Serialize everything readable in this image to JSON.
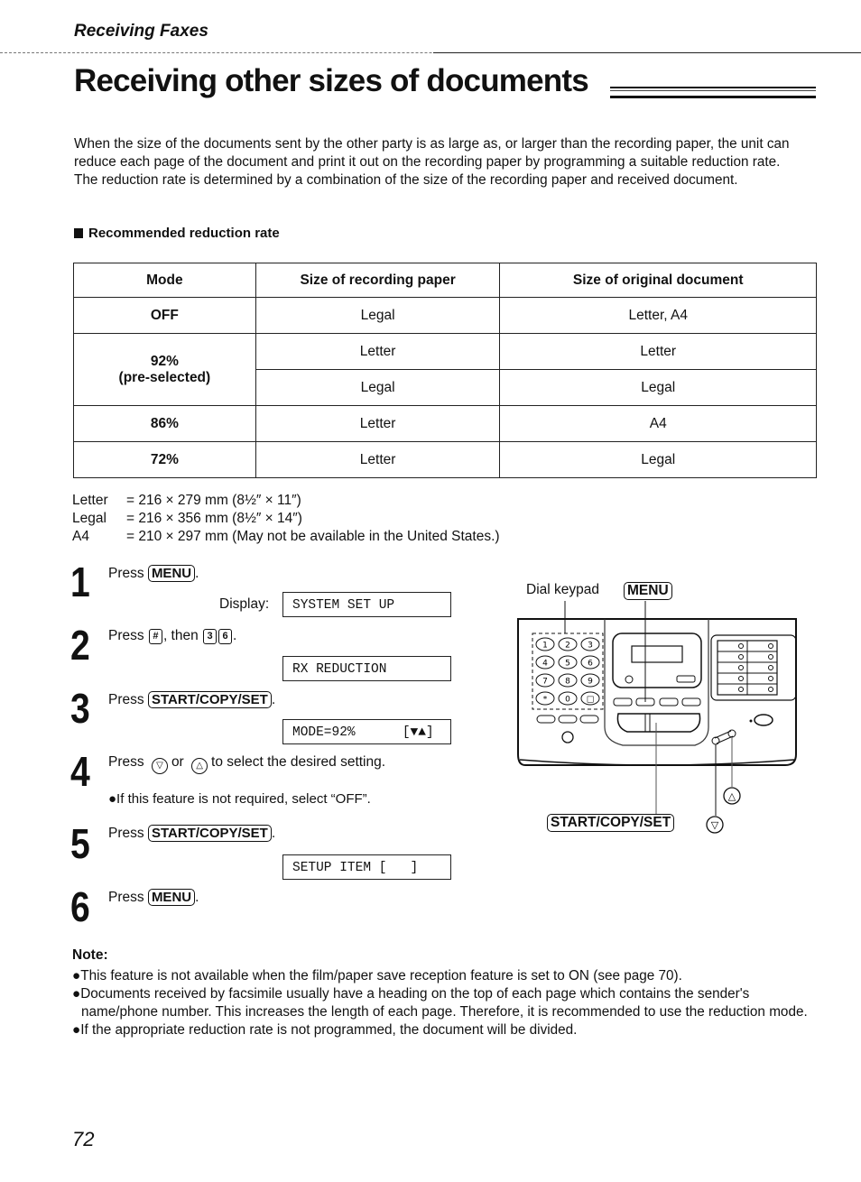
{
  "header": {
    "section": "Receiving Faxes",
    "title": "Receiving other sizes of documents"
  },
  "intro": {
    "paragraph1": "When the size of the documents sent by the other party is as large as, or larger than the recording paper, the unit can reduce each page of the document and print it out on the recording paper by programming a suitable reduction rate.",
    "paragraph2": "The reduction rate is determined by a combination of the size of the recording paper and received document."
  },
  "reduction_table": {
    "heading": "Recommended reduction rate",
    "columns": [
      "Mode",
      "Size of recording paper",
      "Size of original document"
    ],
    "rows": [
      {
        "mode": "OFF",
        "recording_paper": "Legal",
        "original_document": "Letter, A4"
      },
      {
        "mode": "92%",
        "mode_note": "(pre-selected)",
        "recording_paper": "Letter",
        "original_document": "Letter"
      },
      {
        "mode": "92%",
        "recording_paper": "Legal",
        "original_document": "Legal"
      },
      {
        "mode": "86%",
        "recording_paper": "Letter",
        "original_document": "A4"
      },
      {
        "mode": "72%",
        "recording_paper": "Letter",
        "original_document": "Legal"
      }
    ]
  },
  "paper_sizes": [
    {
      "name": "Letter",
      "value": "= 216 × 279 mm (8½″ × 11″)"
    },
    {
      "name": "Legal",
      "value": "= 216 × 356 mm (8½″ × 14″)"
    },
    {
      "name": "A4",
      "value": "= 210 × 297 mm (May not be available in the United States.)"
    }
  ],
  "steps": [
    {
      "number": "1",
      "prefix": "Press",
      "key": "MENU",
      "suffix": ".",
      "display_label": "Display:",
      "display": "SYSTEM SET UP"
    },
    {
      "number": "2",
      "prefix": "Press",
      "key": "#",
      "middle": ", then",
      "keys": [
        "3",
        "6"
      ],
      "suffix": ".",
      "display": "RX REDUCTION"
    },
    {
      "number": "3",
      "prefix": "Press",
      "key": "START/COPY/SET",
      "suffix": ".",
      "display": "MODE=92%      [▼▲]"
    },
    {
      "number": "4",
      "prefix": "Press",
      "key_down": "▽",
      "or": "or",
      "key_up": "△",
      "suffix": "to select the desired setting.",
      "bullet": "●If this feature is not required, select “OFF”."
    },
    {
      "number": "5",
      "prefix": "Press",
      "key": "START/COPY/SET",
      "suffix": ".",
      "display": "SETUP ITEM [   ]"
    },
    {
      "number": "6",
      "prefix": "Press",
      "key": "MENU",
      "suffix": "."
    }
  ],
  "diagram": {
    "dial_keypad_label": "Dial keypad",
    "menu_label": "MENU",
    "start_label": "START/COPY/SET",
    "keypad_keys": [
      "1",
      "2",
      "3",
      "4",
      "5",
      "6",
      "7",
      "8",
      "9",
      "*",
      "0",
      "□"
    ],
    "up_icon": "△",
    "down_icon": "▽"
  },
  "notes": {
    "title": "Note:",
    "items": [
      "●This feature is not available when the film/paper save reception feature is set to ON (see page 70).",
      "●Documents received by facsimile usually have a heading on the top of each page which contains the sender's name/phone number. This increases the length of each page. Therefore, it is recommended to use the reduction mode.",
      "●If the appropriate reduction rate is not programmed, the document will be divided."
    ]
  },
  "page_number": "72"
}
